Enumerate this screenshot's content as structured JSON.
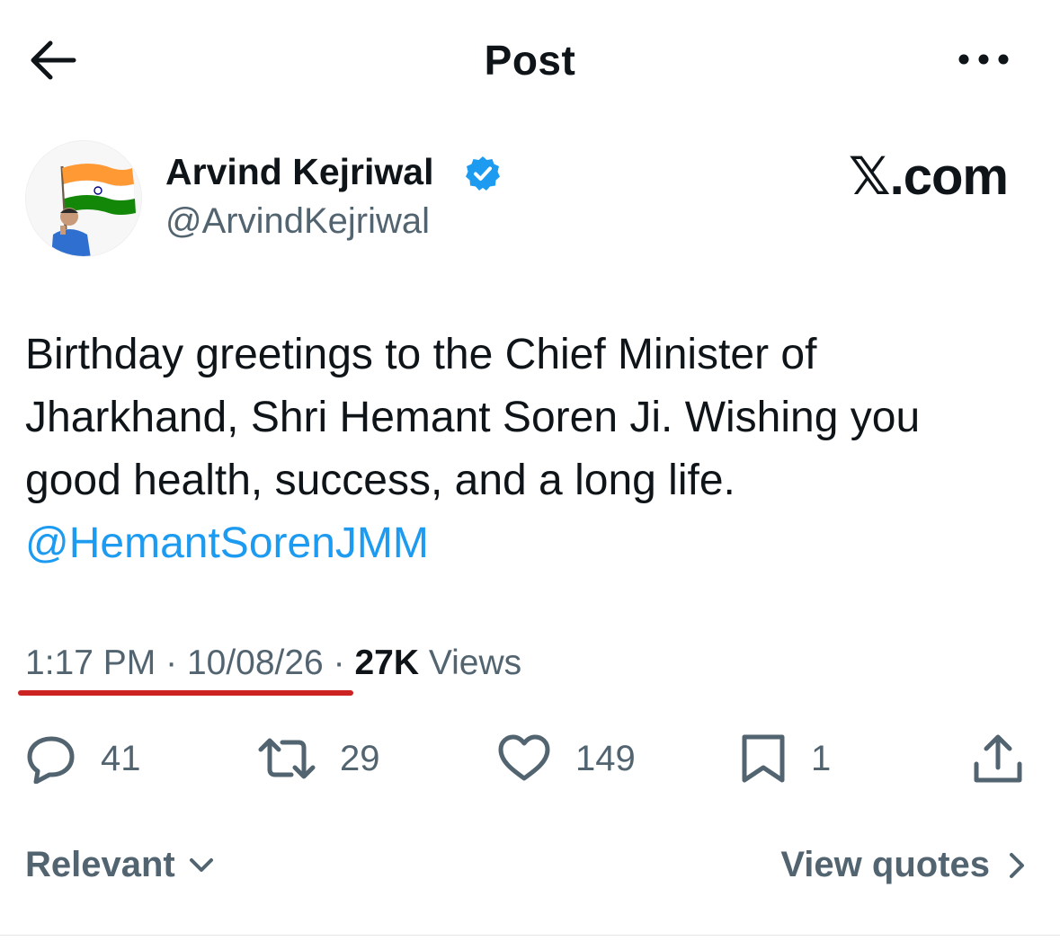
{
  "header": {
    "title": "Post",
    "back_icon": "arrow-left-icon",
    "more_icon": "more-horizontal-icon"
  },
  "author": {
    "name": "Arvind Kejriwal",
    "handle": "@ArvindKejriwal",
    "verified_icon": "verified-badge-icon",
    "verified_color": "#1d9bf0"
  },
  "brand": {
    "label": "𝕏.com"
  },
  "post": {
    "lines": [
      "Birthday greetings to the Chief Minister of",
      "Jharkhand, Shri Hemant Soren Ji. Wishing you",
      "good health, success, and a long life."
    ],
    "mention": "@HemantSorenJMM",
    "mention_color": "#1d9bf0"
  },
  "meta": {
    "time": "1:17 PM",
    "separator": "·",
    "date": "10/08/26",
    "views_count": "27K",
    "views_label": "Views",
    "underline_color": "#cc2222"
  },
  "actions": {
    "reply": {
      "icon": "reply-icon",
      "count": "41"
    },
    "repost": {
      "icon": "repost-icon",
      "count": "29"
    },
    "like": {
      "icon": "heart-icon",
      "count": "149"
    },
    "bookmark": {
      "icon": "bookmark-icon",
      "count": "1"
    },
    "share": {
      "icon": "share-icon"
    }
  },
  "footer": {
    "sort_label": "Relevant",
    "quotes_label": "View quotes"
  }
}
